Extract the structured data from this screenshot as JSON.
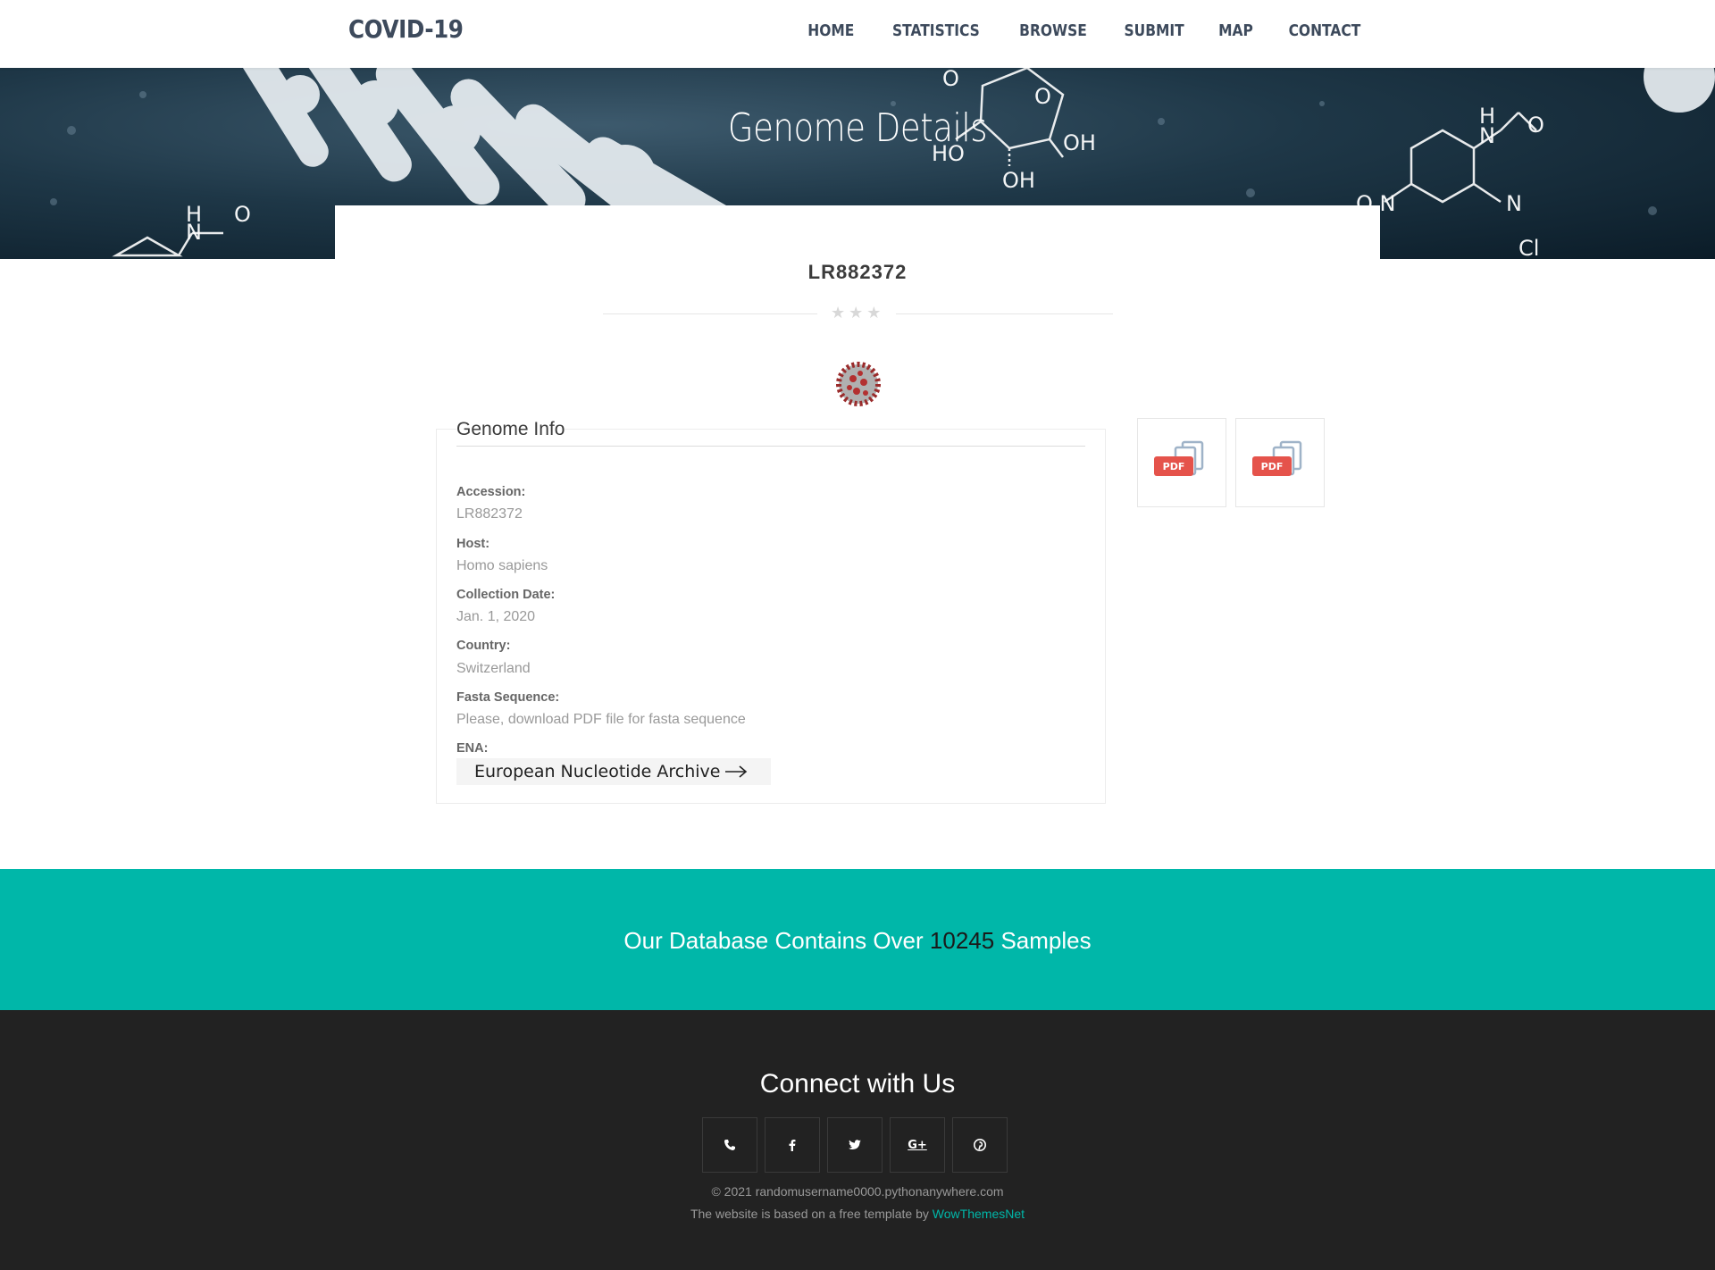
{
  "navbar": {
    "brand": "COVID-19",
    "links": [
      "HOME",
      "STATISTICS",
      "BROWSE",
      "SUBMIT",
      "MAP",
      "CONTACT"
    ]
  },
  "hero": {
    "title": "Genome Details"
  },
  "genome": {
    "title": "LR882372",
    "section_title": "Genome Info",
    "fields": [
      {
        "label": "Accession:",
        "value": "LR882372"
      },
      {
        "label": "Host:",
        "value": "Homo sapiens"
      },
      {
        "label": "Collection Date:",
        "value": "Jan. 1, 2020"
      },
      {
        "label": "Country:",
        "value": "Switzerland"
      },
      {
        "label": "Fasta Sequence:",
        "value": "Please, download PDF file for fasta sequence"
      },
      {
        "label": "ENA:",
        "value": ""
      }
    ],
    "ena_button_label": "European Nucleotide Archive",
    "pdf_badge": "PDF"
  },
  "stats": {
    "prefix": "Our Database Contains Over",
    "count": "10245",
    "suffix": "Samples"
  },
  "footer": {
    "title": "Connect with Us",
    "socials": [
      "phone-icon",
      "facebook-icon",
      "twitter-icon",
      "google-plus-icon",
      "pinterest-icon"
    ],
    "copyright": "© 2021 randomusername0000.pythonanywhere.com",
    "based_on_prefix": "The website is based on a free template by",
    "based_on_link": "WowThemesNet"
  },
  "colors": {
    "accent": "#00b7a9",
    "nav_text": "#3d4a5c",
    "footer_bg": "#222222",
    "pdf_red": "#e5534b"
  }
}
